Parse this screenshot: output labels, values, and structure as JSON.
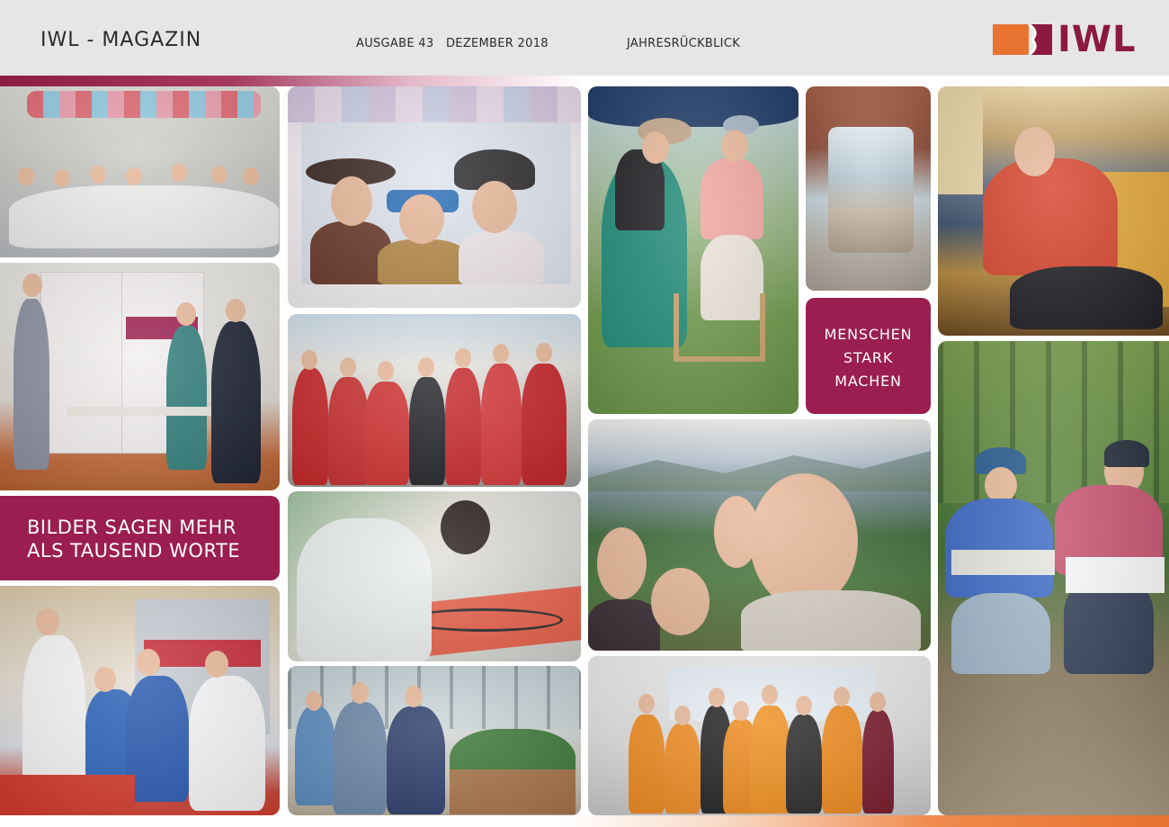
{
  "header": {
    "title": "IWL - MAGAZIN",
    "issue": "AUSGABE 43",
    "date": "DEZEMBER 2018",
    "section": "JAHRESRÜCKBLICK",
    "logo_text": "IWL"
  },
  "captions": {
    "left_line1": "BILDER SAGEN MEHR",
    "left_line2": "ALS TAUSEND WORTE",
    "right_line1": "MENSCHEN",
    "right_line2": "STARK",
    "right_line3": "MACHEN"
  },
  "colors": {
    "brand": "#9b1e50",
    "logo_orange": "#e8722f",
    "header_bg": "#e6e6e6"
  }
}
